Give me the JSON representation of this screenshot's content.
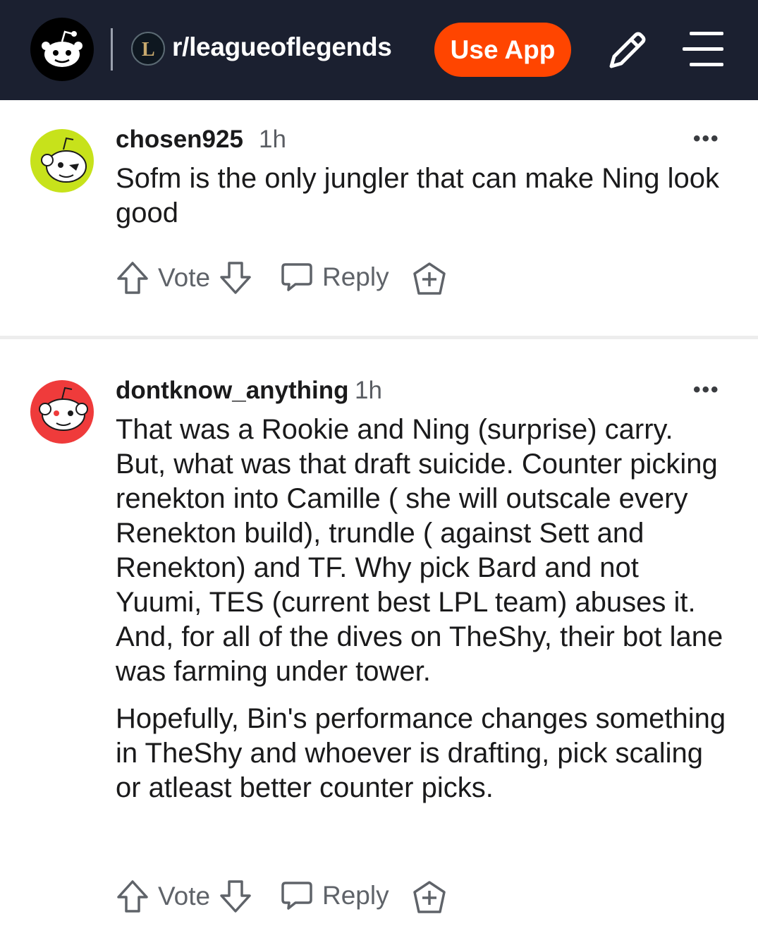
{
  "header": {
    "subreddit": "r/leagueoflegends",
    "use_app_label": "Use App",
    "icons": [
      "reddit-logo-icon",
      "league-logo-icon",
      "pencil-icon",
      "menu-icon"
    ],
    "accent_color": "#ff4500",
    "background_color": "#1b2030"
  },
  "comments": [
    {
      "username": "chosen925",
      "time": "1h",
      "avatar_color": "#c7e21b",
      "body": [
        "Sofm is the only jungler that can make Ning look good"
      ],
      "vote_label": "Vote",
      "reply_label": "Reply"
    },
    {
      "username": "dontknow_anything",
      "time": "1h",
      "avatar_color": "#ef3b3b",
      "body": [
        "That was a Rookie and Ning (surprise) carry. But, what was that draft suicide. Counter picking renekton into Camille ( she will outscale every Renekton build), trundle ( against Sett and Renekton) and TF. Why pick Bard and not Yuumi, TES (current best LPL team) abuses it. And, for all of the dives on TheShy, their bot lane was farming under tower.",
        "Hopefully, Bin's performance changes something in TheShy and whoever is drafting, pick scaling or atleast better counter picks."
      ],
      "vote_label": "Vote",
      "reply_label": "Reply"
    }
  ],
  "more_label": "•••"
}
